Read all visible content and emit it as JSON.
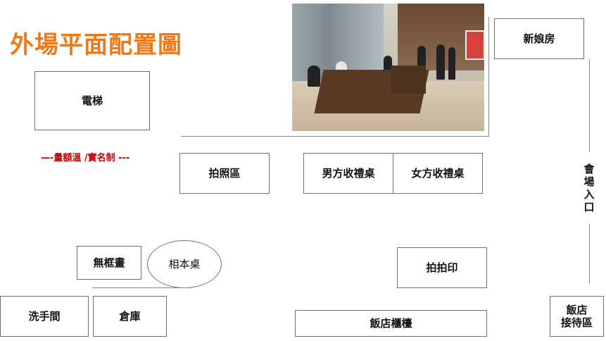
{
  "title": "外場平面配置圖",
  "note": "—-量額溫 /實名制 ---",
  "rooms": {
    "elevator": "電梯",
    "photo_area": "拍照區",
    "groom_table": "男方收禮桌",
    "bride_table": "女方收禮桌",
    "bridal_room": "新娘房",
    "venue_entrance": [
      "會",
      "場",
      "入",
      "口"
    ],
    "frameless_painting": "無框畫",
    "album_table": "相本桌",
    "photo_print": "拍拍印",
    "restroom": "洗手間",
    "storage": "倉庫",
    "hotel_counter": "飯店櫃檯",
    "hotel_reception": [
      "飯店",
      "接待區"
    ]
  },
  "colors": {
    "title": "#f07818",
    "note": "#c00000",
    "border": "#707070"
  }
}
